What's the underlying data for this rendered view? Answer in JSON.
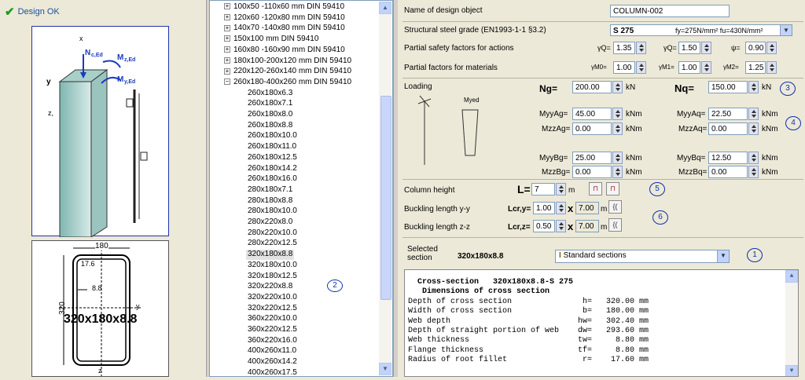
{
  "status": {
    "text": "Design OK"
  },
  "drawing": {
    "n_label": "N",
    "n_sub": "c,Ed",
    "mz_label": "M",
    "mz_sub": "z,Ed",
    "my_label": "M",
    "my_sub": "y,Ed",
    "x_axis": "x",
    "y_axis": "y",
    "z_axis": "z,",
    "dim_width": "180",
    "dim_height": "320",
    "dim_r": "17.6",
    "dim_t": "8.8",
    "section_name": "320x180x8.8",
    "z_bottom": "z",
    "y_side": "y"
  },
  "tree": {
    "groups": [
      {
        "label": "100x50 -110x60 mm  DIN 59410",
        "toggle": "+"
      },
      {
        "label": "120x60 -120x80 mm  DIN 59410",
        "toggle": "+"
      },
      {
        "label": "140x70 -140x80 mm  DIN 59410",
        "toggle": "+"
      },
      {
        "label": "150x100 mm  DIN 59410",
        "toggle": "+"
      },
      {
        "label": "160x80 -160x90 mm  DIN 59410",
        "toggle": "+"
      },
      {
        "label": "180x100-200x120 mm  DIN 59410",
        "toggle": "+"
      },
      {
        "label": "220x120-260x140 mm  DIN 59410",
        "toggle": "+"
      },
      {
        "label": "260x180-400x260 mm  DIN 59410",
        "toggle": "−"
      }
    ],
    "items": [
      "260x180x6.3",
      "260x180x7.1",
      "260x180x8.0",
      "260x180x8.8",
      "260x180x10.0",
      "260x180x11.0",
      "260x180x12.5",
      "260x180x14.2",
      "260x180x16.0",
      "280x180x7.1",
      "280x180x8.8",
      "280x180x10.0",
      "280x220x8.0",
      "280x220x10.0",
      "280x220x12.5",
      "320x180x8.8",
      "320x180x10.0",
      "320x180x12.5",
      "320x220x8.8",
      "320x220x10.0",
      "320x220x12.5",
      "360x220x10.0",
      "360x220x12.5",
      "360x220x16.0",
      "400x260x11.0",
      "400x260x14.2",
      "400x260x17.5"
    ],
    "selected": "320x180x8.8",
    "badge": "2"
  },
  "form": {
    "name_label": "Name of design object",
    "name_value": "COLUMN-002",
    "grade_label": "Structural steel grade (EN1993-1-1 §3.2)",
    "grade_value": "S 275",
    "grade_props": "fy=275N/mm² fu=430N/mm²",
    "psf_actions_label": "Partial safety factors for actions",
    "gQ1_label": "γQ=",
    "gQ1": "1.35",
    "gQ2_label": "γQ=",
    "gQ2": "1.50",
    "psi_label": "ψ=",
    "psi": "0.90",
    "psf_mat_label": "Partial factors for materials",
    "gM0_label": "γM0=",
    "gM0": "1.00",
    "gM1_label": "γM1=",
    "gM1": "1.00",
    "gM2_label": "γM2=",
    "gM2": "1.25",
    "loading_label": "Loading",
    "myed_label": "Myed",
    "ng_label": "Ng=",
    "ng": "200.00",
    "ng_unit": "kN",
    "nq_label": "Nq=",
    "nq": "150.00",
    "nq_unit": "kN",
    "badge3": "3",
    "myyAg_label": "MyyAg=",
    "myyAg": "45.00",
    "mzzAg_label": "MzzAg=",
    "mzzAg": "0.00",
    "myyAq_label": "MyyAq=",
    "myyAq": "22.50",
    "mzzAq_label": "MzzAq=",
    "mzzAq": "0.00",
    "badge4": "4",
    "myyBg_label": "MyyBg=",
    "myyBg": "25.00",
    "mzzBg_label": "MzzBg=",
    "mzzBg": "0.00",
    "myyBq_label": "MyyBq=",
    "myyBq": "12.50",
    "mzzBq_label": "MzzBq=",
    "mzzBq": "0.00",
    "knm": "kNm",
    "height_label": "Column height",
    "L_label": "L=",
    "L": "7",
    "L_unit": "m",
    "badge5": "5",
    "bly_label": "Buckling length y-y",
    "lcry_label": "Lcr,y=",
    "lcry_factor": "1.00",
    "lcry_value": "7.00",
    "lcr_unit": "m",
    "blz_label": "Buckling length z-z",
    "lcrz_label": "Lcr,z=",
    "lcrz_factor": "0.50",
    "lcrz_value": "7.00",
    "badge6": "6",
    "times": "x",
    "selected_label_1": "Selected",
    "selected_label_2": "section",
    "selected_value": "320x180x8.8",
    "std_sections": "Standard sections",
    "badge1": "1"
  },
  "report": {
    "lines": [
      "  Cross-section   320x180x8.8-S 275",
      "   Dimensions of cross section",
      "Depth of cross section               h=   320.00 mm",
      "Width of cross section               b=   180.00 mm",
      "Web depth                           hw=   302.40 mm",
      "Depth of straight portion of web    dw=   293.60 mm",
      "Web thickness                       tw=     8.80 mm",
      "Flange thickness                    tf=     8.80 mm",
      "Radius of root fillet                r=    17.60 mm"
    ]
  }
}
